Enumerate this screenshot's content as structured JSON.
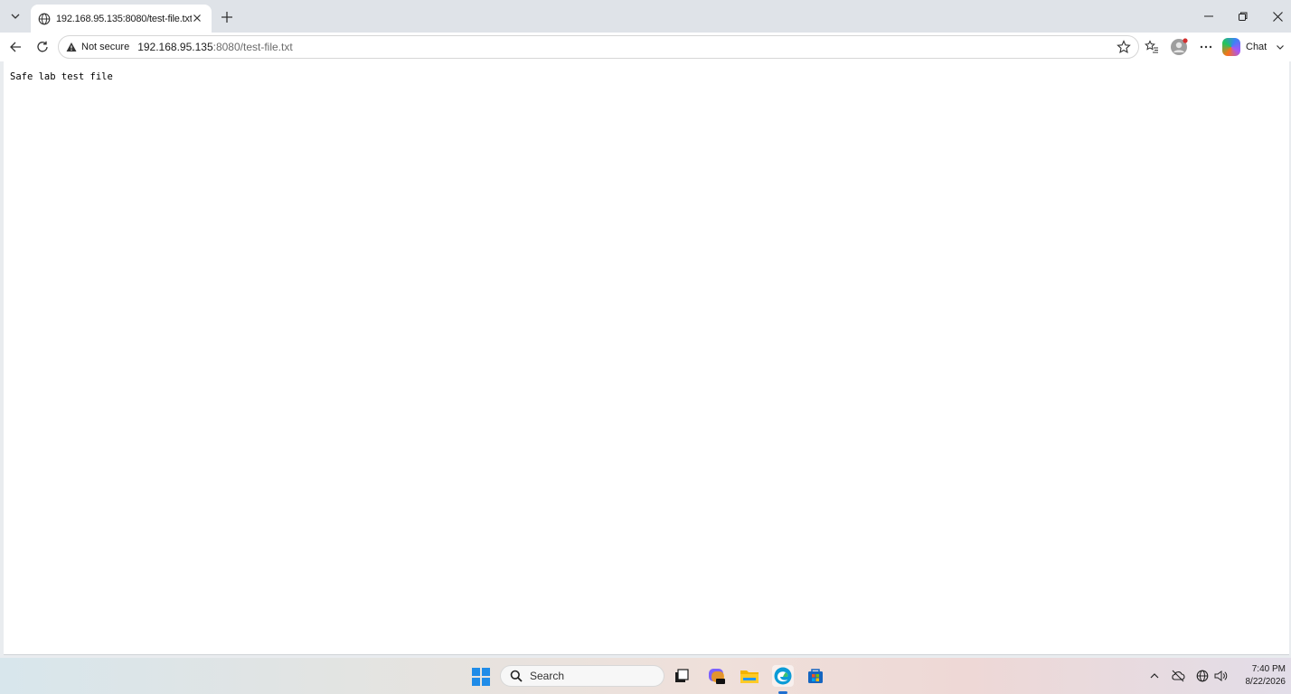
{
  "browser": {
    "tab": {
      "title": "192.168.95.135:8080/test-file.txt"
    },
    "address": {
      "security_label": "Not secure",
      "url_host": "192.168.95.135",
      "url_rest": ":8080/test-file.txt"
    },
    "chat_label": "Chat",
    "icons": [
      "tab-list-chevron-icon",
      "globe-icon",
      "close-icon",
      "plus-icon",
      "back-arrow-icon",
      "refresh-icon",
      "warning-triangle-icon",
      "star-icon",
      "favorites-icon",
      "profile-icon",
      "more-icon",
      "copilot-icon",
      "chevron-down-icon",
      "minimize-icon",
      "restore-icon",
      "window-close-icon"
    ]
  },
  "page": {
    "text": "Safe lab test file"
  },
  "taskbar": {
    "search_placeholder": "Search",
    "clock": {
      "time": "7:40 PM",
      "date": "8/22/2026"
    },
    "accent": "#1f8ce8"
  }
}
